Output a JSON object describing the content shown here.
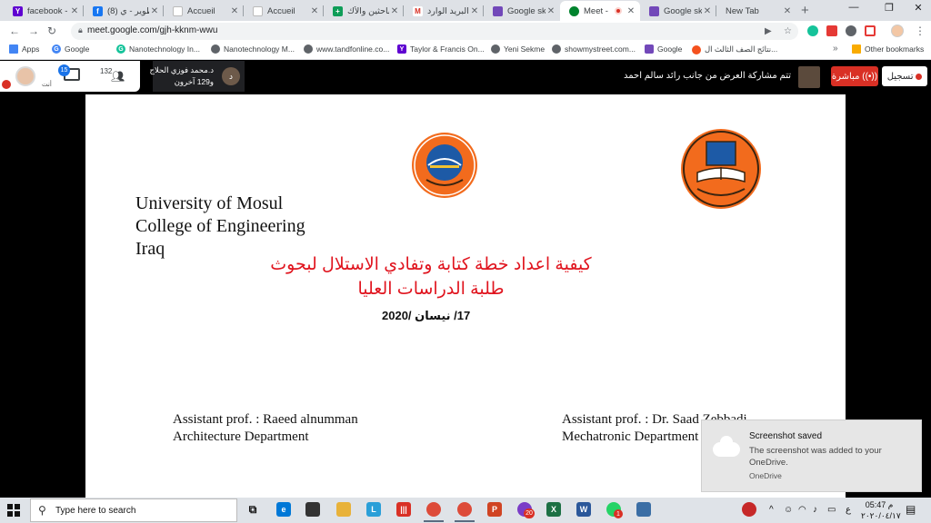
{
  "tabs": [
    {
      "title": "facebook - Y",
      "fav_color": "#5f01d1",
      "fav_glyph": "Y",
      "icon": "yahoo-icon"
    },
    {
      "title": "(8) تطوير - ي",
      "fav_color": "#1877f2",
      "fav_glyph": "f",
      "icon": "facebook-icon"
    },
    {
      "title": "Accueil",
      "fav_color": "#ffffff",
      "fav_glyph": "",
      "icon": "page-icon"
    },
    {
      "title": "Accueil",
      "fav_color": "#ffffff",
      "fav_glyph": "",
      "icon": "page-icon"
    },
    {
      "title": "الباحثين والأك",
      "fav_color": "#0f9d58",
      "fav_glyph": "+",
      "icon": "sheets-icon"
    },
    {
      "title": "البريد الوارد",
      "fav_color": "#ffffff",
      "fav_glyph": "M",
      "icon": "gmail-icon"
    },
    {
      "title": "Google sket",
      "fav_color": "#7248b9",
      "fav_glyph": "",
      "icon": "forms-icon"
    },
    {
      "title": "Meet - ",
      "fav_color": "#00832d",
      "fav_glyph": "",
      "icon": "meet-icon",
      "active": true
    },
    {
      "title": "Google sket",
      "fav_color": "#7248b9",
      "fav_glyph": "",
      "icon": "forms-icon"
    },
    {
      "title": "New Tab",
      "fav_color": "#dee1e6",
      "fav_glyph": "",
      "icon": "newtab-icon"
    }
  ],
  "address": {
    "url": "meet.google.com/gjh-kknm-wwu"
  },
  "bookmarks": [
    {
      "label": "Apps",
      "icon": "apps-grid-icon",
      "color": "#4285f4"
    },
    {
      "label": "Google",
      "icon": "google-icon",
      "color": "#4285f4"
    },
    {
      "label": "Nanotechnology In...",
      "icon": "grammarly-icon",
      "color": "#15c39a"
    },
    {
      "label": "Nanotechnology M...",
      "icon": "globe-icon",
      "color": "#5f6368"
    },
    {
      "label": "www.tandfonline.co...",
      "icon": "globe-icon",
      "color": "#5f6368"
    },
    {
      "label": "Taylor & Francis On...",
      "icon": "yahoo-icon",
      "color": "#5f01d1"
    },
    {
      "label": "Yeni Sekme",
      "icon": "globe-icon",
      "color": "#5f6368"
    },
    {
      "label": "showmystreet.com...",
      "icon": "globe-icon",
      "color": "#5f6368"
    },
    {
      "label": "Google",
      "icon": "forms-icon",
      "color": "#7248b9"
    },
    {
      "label": "نتائج الصف الثالث ال...",
      "icon": "results-icon",
      "color": "#f4511e"
    },
    {
      "label": "Other bookmarks",
      "icon": "folder-icon",
      "color": "#f9ab00"
    }
  ],
  "meet": {
    "self_label": "أنت",
    "chat_badge": "15",
    "people_count": "132",
    "presenter_name": "د.محمد فوزي الحلاج",
    "others_count": "و129 آخرون",
    "presenter_initial": "د",
    "presenting_text": "تتم مشاركة العرض من جانب رائد سالم احمد",
    "live_label": "مباشرة",
    "record_label": "تسجيل"
  },
  "slide": {
    "university": "University of Mosul",
    "college": "College of Engineering",
    "country": "Iraq",
    "title_line1": "كيفية اعداد خطة كتابة وتفادي الاستلال لبحوث",
    "title_line2": "طلبة الدراسات العليا",
    "date": "17/ نيسان /2020",
    "presenter_left_title": "Assistant prof.   : Raeed alnumman",
    "presenter_left_dept": "Architecture Department",
    "presenter_right_title": "Assistant prof.   : Dr. Saad Zebbadi",
    "presenter_right_dept": "Mechatronic Department",
    "logo_colors": {
      "orange": "#f26b1d",
      "blue": "#1d5aa6",
      "dark": "#3a2410"
    }
  },
  "toast": {
    "title": "Screenshot saved",
    "body": "The screenshot was added to your OneDrive.",
    "source": "OneDrive"
  },
  "taskbar": {
    "search_placeholder": "Type here to search",
    "time": "05:47 م",
    "date": "٢٠٢٠/٠٤/١٧",
    "lang": "ع",
    "notif_count": "20",
    "badge1": "1"
  }
}
